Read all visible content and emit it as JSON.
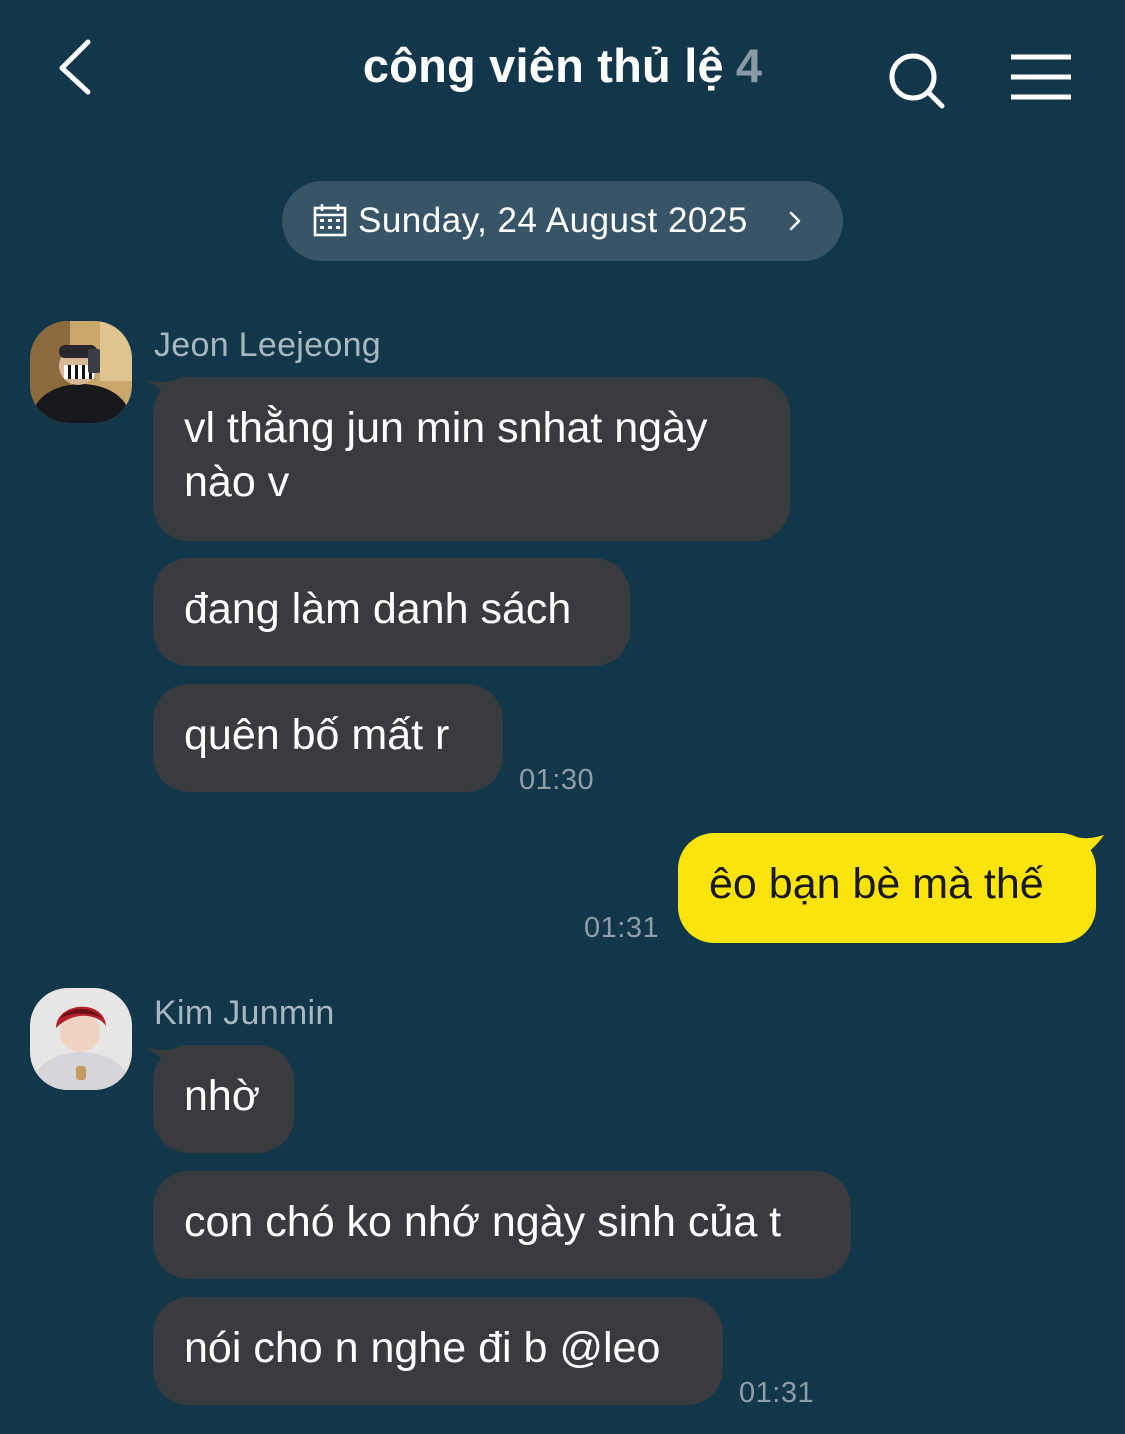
{
  "header": {
    "title": "công viên thủ lệ",
    "member_count": "4",
    "back_icon": "chevron-left-icon",
    "search_icon": "search-icon",
    "menu_icon": "hamburger-menu-icon"
  },
  "date_divider": {
    "label": "Sunday, 24 August 2025",
    "calendar_icon": "calendar-icon",
    "chevron_icon": "chevron-right-icon"
  },
  "messages": [
    {
      "sender": "Jeon Leejeong",
      "bubbles": [
        "vl thằng jun min snhat ngày\nnào v",
        "đang làm danh sách",
        "quên bố mất r"
      ],
      "time": "01:30"
    },
    {
      "sender": "me",
      "bubbles": [
        "êo bạn bè mà thế"
      ],
      "time": "01:31"
    },
    {
      "sender": "Kim Junmin",
      "bubbles": [
        "nhờ",
        "con chó ko nhớ ngày sinh của t",
        "nói cho n nghe đi b @leo"
      ],
      "time": "01:31"
    }
  ],
  "colors": {
    "background": "#13374a",
    "incoming_bubble": "#3a3b3e",
    "outgoing_bubble": "#fbe40b",
    "date_pill": "#385567",
    "muted_text": "#8e9ea9"
  }
}
